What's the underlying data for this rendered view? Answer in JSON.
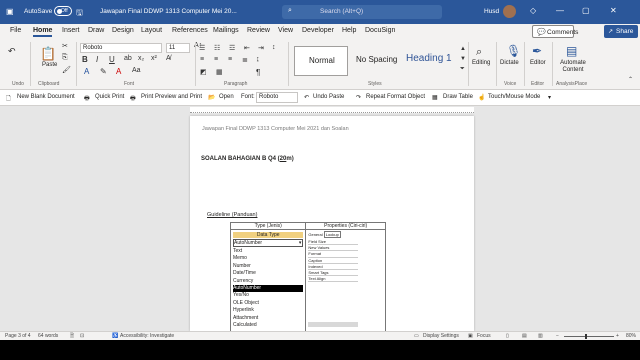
{
  "titlebar": {
    "autosave": "AutoSave",
    "toggle": "Off",
    "doc_title": "Jawapan Final DDWP 1313 Computer Mei 20...",
    "search_placeholder": "Search (Alt+Q)",
    "user": "Husd"
  },
  "tabs": [
    "File",
    "Home",
    "Insert",
    "Draw",
    "Design",
    "Layout",
    "References",
    "Mailings",
    "Review",
    "View",
    "Developer",
    "Help",
    "DocuSign"
  ],
  "active_tab": "Home",
  "comments_label": "Comments",
  "share_label": "Share",
  "ribbon": {
    "paste": "Paste",
    "clipboard": "Clipboard",
    "undo": "Undo",
    "font_name": "Roboto",
    "font_size": "11",
    "font_group": "Font",
    "paragraph_group": "Paragraph",
    "styles": [
      "Normal",
      "No Spacing",
      "Heading 1"
    ],
    "styles_group": "Styles",
    "editing": "Editing",
    "dictate": "Dictate",
    "voice": "Voice",
    "editor": "Editor",
    "editor_group": "Editor",
    "automate": "Automate Content",
    "analysis": "AnalysisPlace"
  },
  "qat": {
    "new_blank": "New Blank Document",
    "quick_print": "Quick Print",
    "print_preview": "Print Preview and Print",
    "open": "Open",
    "font_label": "Font:",
    "font_value": "Roboto",
    "undo_paste": "Undo Paste",
    "repeat": "Repeat Format Object",
    "draw_table": "Draw Table",
    "touch": "Touch/Mouse Mode"
  },
  "doc": {
    "header": "Jawapan Final DDWP 1313 Computer Mei 2021 dan Soalan",
    "section_title": "SOALAN BAHAGIAN B Q4 (",
    "section_marks": "20",
    "section_end": "m)",
    "guideline": "Guideline (Panduan)",
    "col1": "Type (Jenis)",
    "col2": "Properties (Ciri-ciri)",
    "data_type": "Data Type",
    "selected_type": "AutoNumber",
    "types": [
      "Text",
      "Memo",
      "Number",
      "Date/Time",
      "Currency",
      "AutoNumber",
      "Yes/No",
      "OLE Object",
      "Hyperlink",
      "Attachment",
      "Calculated"
    ],
    "prop_tabs": [
      "General",
      "Lookup"
    ],
    "props": [
      "Field Size",
      "New Values",
      "Format",
      "Caption",
      "Indexed",
      "Smart Tags",
      "Text Align"
    ]
  },
  "status": {
    "page": "Page 3 of 4",
    "words": "64 words",
    "accessibility": "Accessibility: Investigate",
    "display": "Display Settings",
    "focus": "Focus",
    "zoom": "80%"
  }
}
